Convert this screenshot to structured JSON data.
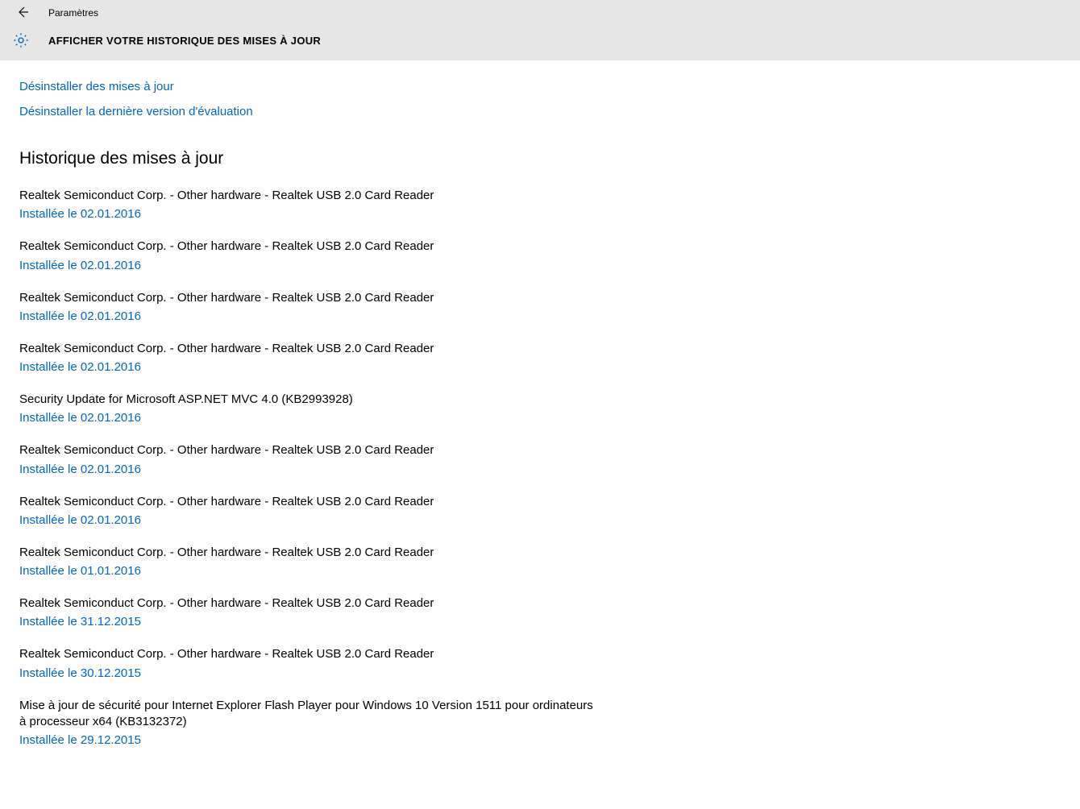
{
  "header": {
    "app_name": "Paramètres",
    "page_title": "AFFICHER VOTRE HISTORIQUE DES MISES À JOUR"
  },
  "links": {
    "uninstall_updates": "Désinstaller des mises à jour",
    "uninstall_preview": "Désinstaller la dernière version d'évaluation"
  },
  "section_heading": "Historique des mises à jour",
  "updates": [
    {
      "title": "Realtek Semiconduct Corp. - Other hardware - Realtek USB 2.0 Card Reader",
      "status": "Installée le 02.01.2016"
    },
    {
      "title": "Realtek Semiconduct Corp. - Other hardware - Realtek USB 2.0 Card Reader",
      "status": "Installée le 02.01.2016"
    },
    {
      "title": "Realtek Semiconduct Corp. - Other hardware - Realtek USB 2.0 Card Reader",
      "status": "Installée le 02.01.2016"
    },
    {
      "title": "Realtek Semiconduct Corp. - Other hardware - Realtek USB 2.0 Card Reader",
      "status": "Installée le 02.01.2016"
    },
    {
      "title": "Security Update for Microsoft ASP.NET MVC 4.0 (KB2993928)",
      "status": "Installée le 02.01.2016"
    },
    {
      "title": "Realtek Semiconduct Corp. - Other hardware - Realtek USB 2.0 Card Reader",
      "status": "Installée le 02.01.2016"
    },
    {
      "title": "Realtek Semiconduct Corp. - Other hardware - Realtek USB 2.0 Card Reader",
      "status": "Installée le 02.01.2016"
    },
    {
      "title": "Realtek Semiconduct Corp. - Other hardware - Realtek USB 2.0 Card Reader",
      "status": "Installée le 01.01.2016"
    },
    {
      "title": "Realtek Semiconduct Corp. - Other hardware - Realtek USB 2.0 Card Reader",
      "status": "Installée le 31.12.2015"
    },
    {
      "title": "Realtek Semiconduct Corp. - Other hardware - Realtek USB 2.0 Card Reader",
      "status": "Installée le 30.12.2015"
    },
    {
      "title": "Mise à jour de sécurité pour Internet Explorer Flash Player pour Windows 10 Version 1511 pour ordinateurs à processeur x64 (KB3132372)",
      "status": "Installée le 29.12.2015"
    }
  ]
}
